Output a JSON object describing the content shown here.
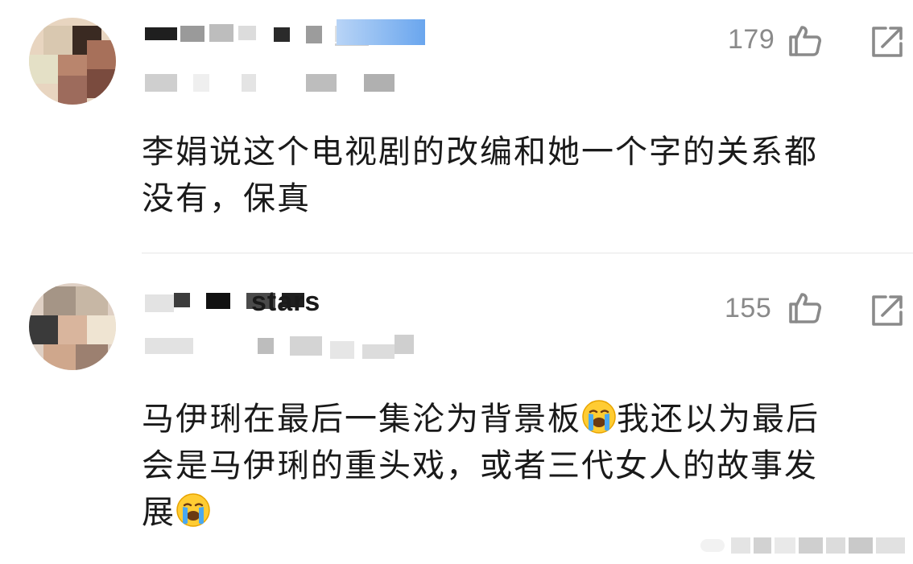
{
  "comments": [
    {
      "like_count": "179",
      "lines": [
        "李娟说这个电视剧的改编和她一个字的关系都",
        "没有，保真"
      ]
    },
    {
      "username_partial": "stars",
      "like_count": "155",
      "lines": [
        "马伊琍在最后一集沦为背景板",
        "我还以为最后",
        "会是马伊琍的重头戏，或者三代女人的故事发",
        "展"
      ]
    }
  ],
  "icons": {
    "like": "thumbs-up-icon",
    "share": "share-icon",
    "emoji": "loudly-crying-face-emoji"
  },
  "colors": {
    "text": "#1a1a1a",
    "meta": "#8a8a8a",
    "accent_blur": "#6aa6ee"
  }
}
